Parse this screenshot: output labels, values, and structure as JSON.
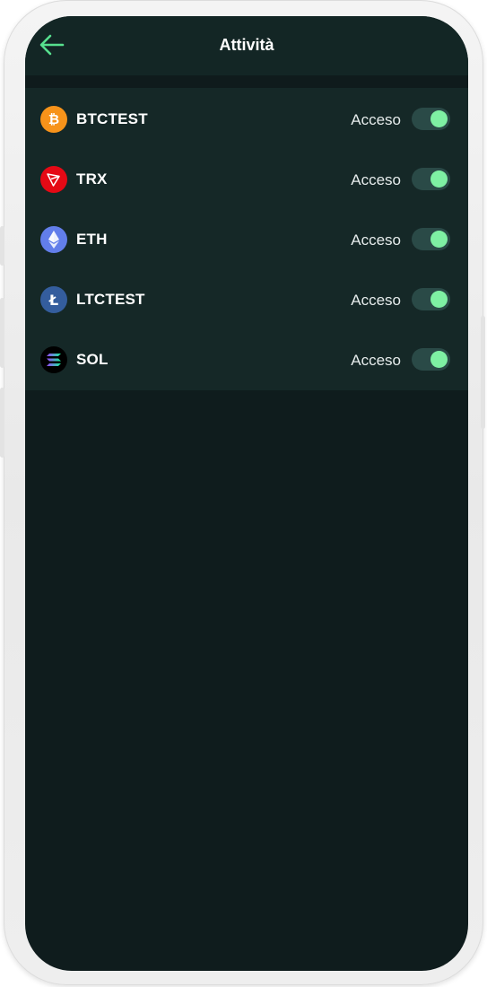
{
  "header": {
    "title": "Attività",
    "back_icon": "arrow-left-icon",
    "accent": "#57e08e"
  },
  "coins": [
    {
      "name": "BTCTEST",
      "status": "Acceso",
      "enabled": true,
      "icon": "bitcoin-icon",
      "color": "#f7931a",
      "glyph": "₿"
    },
    {
      "name": "TRX",
      "status": "Acceso",
      "enabled": true,
      "icon": "tron-icon",
      "color": "#e50915",
      "glyph": ""
    },
    {
      "name": "ETH",
      "status": "Acceso",
      "enabled": true,
      "icon": "ethereum-icon",
      "color": "#627eea",
      "glyph": ""
    },
    {
      "name": "LTCTEST",
      "status": "Acceso",
      "enabled": true,
      "icon": "litecoin-icon",
      "color": "#345d9d",
      "glyph": "Ł"
    },
    {
      "name": "SOL",
      "status": "Acceso",
      "enabled": true,
      "icon": "solana-icon",
      "color": "#000000",
      "glyph": ""
    }
  ],
  "colors": {
    "background": "#0f1c1d",
    "panel": "#152827",
    "toggle_track": "#2a4a47",
    "toggle_knob": "#7ef0a3"
  }
}
